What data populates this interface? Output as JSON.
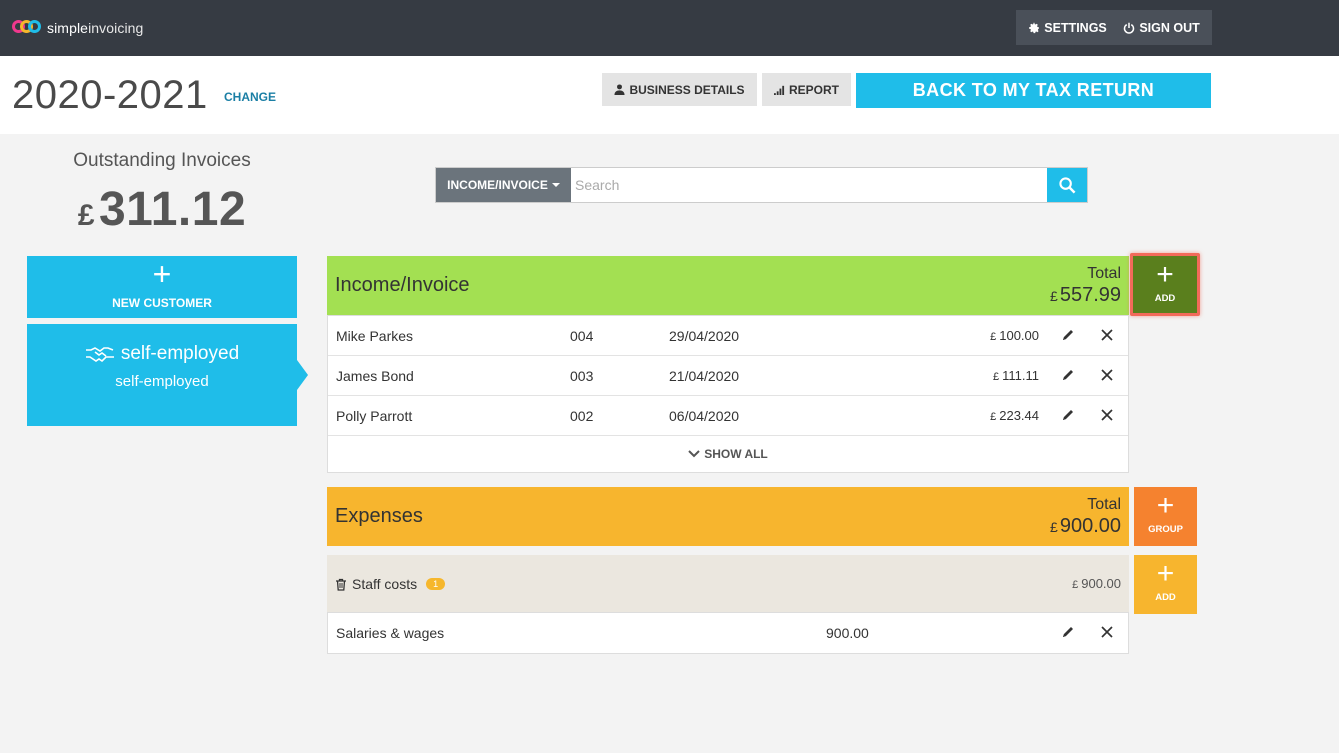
{
  "brand": {
    "name_bold": "simple",
    "name_rest": "invoicing"
  },
  "nav": {
    "settings_label": "SETTINGS",
    "signout_label": "SIGN OUT"
  },
  "header": {
    "tax_year": "2020-2021",
    "change_label": "CHANGE",
    "business_details_label": "BUSINESS DETAILS",
    "report_label": "REPORT",
    "back_label": "BACK TO MY TAX RETURN"
  },
  "sidebar": {
    "outstanding_label": "Outstanding Invoices",
    "outstanding_currency": "£",
    "outstanding_amount": "311.12",
    "new_customer_label": "NEW CUSTOMER",
    "customer": {
      "name": "self-employed",
      "subtitle": "self-employed"
    }
  },
  "search": {
    "type_label": "INCOME/INVOICE",
    "placeholder": "Search",
    "value": ""
  },
  "income": {
    "title": "Income/Invoice",
    "total_label": "Total",
    "total_currency": "£",
    "total_amount": "557.99",
    "add_label": "ADD",
    "rows": [
      {
        "customer": "Mike Parkes",
        "number": "004",
        "date": "29/04/2020",
        "currency": "£",
        "amount": "100.00"
      },
      {
        "customer": "James Bond",
        "number": "003",
        "date": "21/04/2020",
        "currency": "£",
        "amount": "111.11"
      },
      {
        "customer": "Polly Parrott",
        "number": "002",
        "date": "06/04/2020",
        "currency": "£",
        "amount": "223.44"
      }
    ],
    "show_all_label": "SHOW ALL"
  },
  "expenses": {
    "title": "Expenses",
    "total_label": "Total",
    "total_currency": "£",
    "total_amount": "900.00",
    "group_button_label": "GROUP",
    "add_label": "ADD",
    "groups": [
      {
        "name": "Staff costs",
        "count": "1",
        "currency": "£",
        "total": "900.00",
        "items": [
          {
            "description": "Salaries & wages",
            "amount": "900.00"
          }
        ]
      }
    ]
  },
  "colors": {
    "topbar": "#363b43",
    "accent_blue": "#1fbde9",
    "income_green": "#a3e052",
    "add_dark_green": "#5a7f1d",
    "highlight_red": "#f26a5a",
    "expenses_orange": "#f7b52e",
    "group_orange": "#f5822f"
  }
}
